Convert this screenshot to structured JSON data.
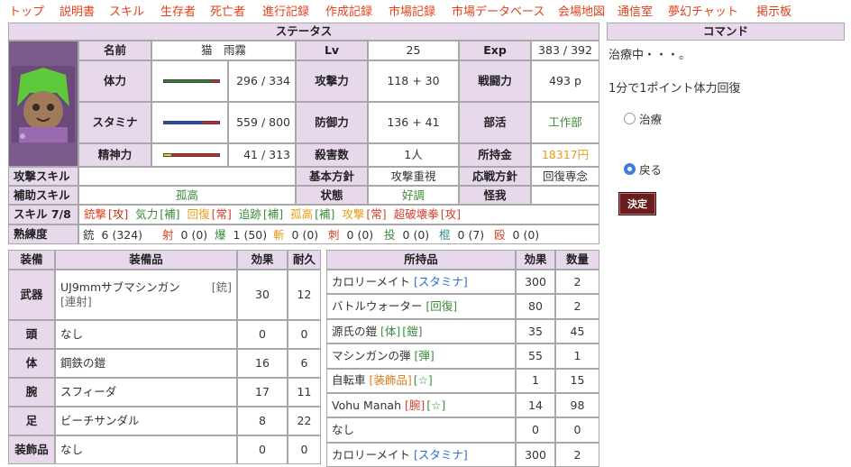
{
  "nav": [
    "トップ",
    "説明書",
    "スキル",
    "生存者",
    "死亡者",
    "進行記録",
    "作成記録",
    "市場記録",
    "市場データベース",
    "会場地図",
    "通信室",
    "夢幻チャット",
    "掲示板"
  ],
  "status": {
    "title": "ステータス",
    "labels": {
      "name": "名前",
      "lv": "Lv",
      "exp": "Exp",
      "hp": "体力",
      "attack": "攻撃力",
      "power": "戦闘力",
      "stamina": "スタミナ",
      "defense": "防御力",
      "club": "部活",
      "mind": "精神力",
      "kills": "殺害数",
      "money": "所持金",
      "atk_skill": "攻撃スキル",
      "policy": "基本方針",
      "response": "応戦方針",
      "sup_skill": "補助スキル",
      "condition": "状態",
      "injury": "怪我",
      "skill": "スキル 7/8",
      "proficiency": "熟練度"
    },
    "name": "猫　雨霧",
    "lv": "25",
    "exp": "383 / 392",
    "hp": "296 / 334",
    "hp_fraction": 0.886,
    "attack": "118 + 30",
    "power": "493 p",
    "stamina": "559 / 800",
    "stamina_fraction": 0.699,
    "defense": "136 + 41",
    "club": "工作部",
    "mind": "41 / 313",
    "mind_fraction": 0.131,
    "kills": "1人",
    "money": "18317円",
    "atk_skill": "",
    "policy": "攻撃重視",
    "response": "回復専念",
    "sup_skill": "孤高",
    "condition": "好調",
    "injury": "",
    "skills": [
      {
        "name": "銃撃",
        "tag": "[攻]",
        "color": "#e0401a",
        "tagcolor": "#c0301a"
      },
      {
        "name": "気力",
        "tag": "[補]",
        "color": "#3a8c3a",
        "tagcolor": "#3a8c3a"
      },
      {
        "name": "回復",
        "tag": "[常]",
        "color": "#e89b16",
        "tagcolor": "#d6402a"
      },
      {
        "name": "追跡",
        "tag": "[補]",
        "color": "#3a8c3a",
        "tagcolor": "#3a8c3a"
      },
      {
        "name": "孤高",
        "tag": "[補]",
        "color": "#e89b16",
        "tagcolor": "#3a8c3a"
      },
      {
        "name": "攻撃",
        "tag": "[常]",
        "color": "#e89b16",
        "tagcolor": "#d6402a"
      },
      {
        "name": "超破壊拳",
        "tag": "[攻]",
        "color": "#d6402a",
        "tagcolor": "#d6402a"
      }
    ],
    "proficiency": [
      {
        "label": "銃",
        "value": "6 (324)",
        "color": "#333"
      },
      {
        "label": "射",
        "value": "0 (0)",
        "color": "#e0401a"
      },
      {
        "label": "爆",
        "value": "1 (50)",
        "color": "#3a8c3a"
      },
      {
        "label": "斬",
        "value": "0 (0)",
        "color": "#e89b16"
      },
      {
        "label": "刺",
        "value": "0 (0)",
        "color": "#d6402a"
      },
      {
        "label": "投",
        "value": "0 (0)",
        "color": "#3a8c3a"
      },
      {
        "label": "棍",
        "value": "0 (7)",
        "color": "#2f8c8c"
      },
      {
        "label": "殴",
        "value": "0 (0)",
        "color": "#d6402a"
      }
    ]
  },
  "equipment": {
    "headers": [
      "装備",
      "装備品",
      "効果",
      "耐久"
    ],
    "rows": [
      {
        "slot": "武器",
        "item": "UJ9mmサブマシンガン",
        "tag1": "[銃]",
        "tag2": "[連射]",
        "effect": "30",
        "durability": "12"
      },
      {
        "slot": "頭",
        "item": "なし",
        "tag1": "",
        "tag2": "",
        "effect": "0",
        "durability": "0"
      },
      {
        "slot": "体",
        "item": "鋼鉄の鎧",
        "tag1": "",
        "tag2": "",
        "effect": "16",
        "durability": "6"
      },
      {
        "slot": "腕",
        "item": "スフィーダ",
        "tag1": "",
        "tag2": "",
        "effect": "17",
        "durability": "11"
      },
      {
        "slot": "足",
        "item": "ビーチサンダル",
        "tag1": "",
        "tag2": "",
        "effect": "8",
        "durability": "22"
      },
      {
        "slot": "装飾品",
        "item": "なし",
        "tag1": "",
        "tag2": "",
        "effect": "0",
        "durability": "0"
      }
    ]
  },
  "inventory": {
    "headers": [
      "所持品",
      "効果",
      "数量"
    ],
    "rows": [
      {
        "item": "カロリーメイト",
        "tags": [
          {
            "t": "[スタミナ]",
            "c": "#2f6fc9"
          }
        ],
        "effect": "300",
        "qty": "2"
      },
      {
        "item": "バトルウォーター",
        "tags": [
          {
            "t": "[回復]",
            "c": "#3a8c3a"
          }
        ],
        "effect": "80",
        "qty": "2"
      },
      {
        "item": "源氏の鎧",
        "tags": [
          {
            "t": "[体]",
            "c": "#3a8c3a"
          },
          {
            "t": "[鎧]",
            "c": "#3a8c3a"
          }
        ],
        "effect": "35",
        "qty": "45"
      },
      {
        "item": "マシンガンの弾",
        "tags": [
          {
            "t": "[弾]",
            "c": "#3a8c3a"
          }
        ],
        "effect": "55",
        "qty": "1"
      },
      {
        "item": "自転車",
        "tags": [
          {
            "t": "[装飾品]",
            "c": "#e07a1a"
          },
          {
            "t": "[☆]",
            "c": "#3a8c3a"
          }
        ],
        "effect": "1",
        "qty": "15"
      },
      {
        "item": "Vohu Manah",
        "tags": [
          {
            "t": "[腕]",
            "c": "#d6402a"
          },
          {
            "t": "[☆]",
            "c": "#3a8c3a"
          }
        ],
        "effect": "14",
        "qty": "98"
      },
      {
        "item": "なし",
        "tags": [],
        "effect": "0",
        "qty": "0"
      },
      {
        "item": "カロリーメイト",
        "tags": [
          {
            "t": "[スタミナ]",
            "c": "#2f6fc9"
          }
        ],
        "effect": "300",
        "qty": "2"
      }
    ]
  },
  "command": {
    "title": "コマンド",
    "status_text": "治療中・・・。",
    "info_text": "1分で1ポイント体力回復",
    "options": [
      {
        "label": "治療",
        "selected": false
      },
      {
        "label": "戻る",
        "selected": true
      }
    ],
    "ok_label": "決定"
  },
  "colors": {
    "header_bg": "#e8d8ec",
    "nav_link": "#e0401a",
    "hp_bar": "#2e7d32",
    "stamina_bar": "#1a4fd6",
    "mind_bar": "#e8d81a",
    "bar_empty": "#e02020",
    "ok_button": "#6b1c1c"
  }
}
